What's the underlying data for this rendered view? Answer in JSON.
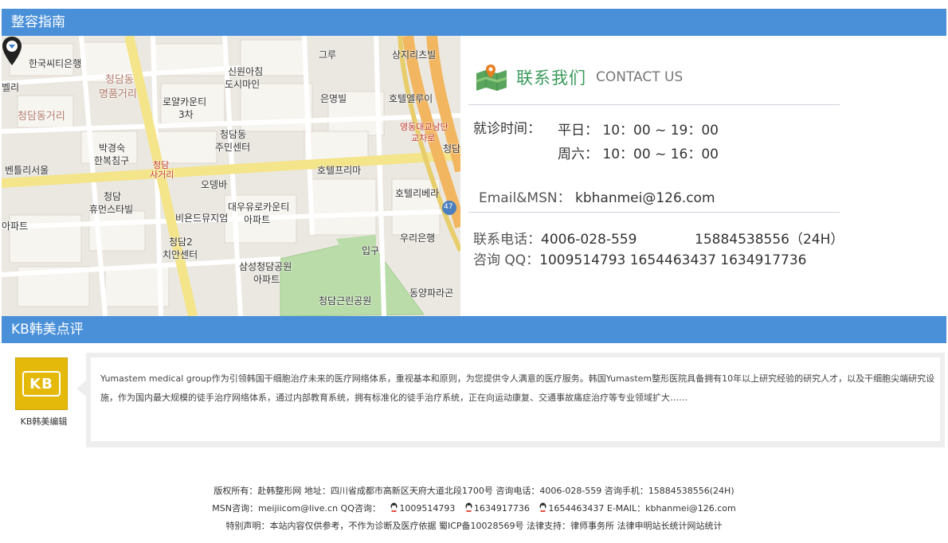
{
  "sections": {
    "guide_title": "整容指南",
    "review_title": "KB韩美点评"
  },
  "map": {
    "labels": [
      "한국씨티은행",
      "청담동",
      "명품거리",
      "청담동거리",
      "벨리",
      "로얄카운티",
      "3차",
      "신원아침",
      "도시마인",
      "그루",
      "상지리츠빌",
      "은명빌",
      "호텔엘루이",
      "영동대교남단",
      "교차로",
      "청담",
      "청담동",
      "주민센터",
      "박경숙",
      "한복침구",
      "벤틀리서울",
      "청담",
      "사거리",
      "오뎅바",
      "호텔프리마",
      "호텔리베라",
      "47",
      "청담",
      "휴먼스타빌",
      "비욘드뮤지엄",
      "대우유로카운티",
      "아파트",
      "청담2",
      "치안센터",
      "입구",
      "우리은행",
      "삼성청담공원",
      "아파트",
      "동양파라곤",
      "청담근린공원",
      "아파트"
    ]
  },
  "contact": {
    "title_cn": "联系我们",
    "title_en": "CONTACT US",
    "hours_label": "就诊时间：",
    "weekday": "平日： 10：00 ~ 19：00",
    "saturday": "周六： 10：00 ~ 16：00",
    "email_label": "Email&MSN：",
    "email_value": "kbhanmei@126.com",
    "phone_label": "联系电话：",
    "phone_value": "4006-028-559",
    "mobile_value": "15884538556（24H）",
    "qq_label": "咨询 QQ：",
    "qq_value": "1009514793  1654463437  1634917736"
  },
  "review": {
    "logo_text": "KB",
    "editor": "KB韩美编辑",
    "text": "Yumastem medical group作为引领韩国干细胞治疗未来的医疗网络体系，重视基本和原则，为您提供令人满意的医疗服务。韩国Yumastem整形医院具备拥有10年以上研究经验的研究人才，以及干细胞尖端研究设施，作为国内最大规模的徒手治疗网络体系，通过内部教育系统，拥有标准化的徒手治疗系统，正在向运动康复、交通事故痛症治疗等专业领域扩大……"
  },
  "footer": {
    "line1": "版权所有：赴韩整形网 地址：四川省成都市高新区天府大道北段1700号 咨询电话：4006-028-559 咨询手机：15884538556(24H)",
    "msn": "MSN咨询：meijiicom@live.cn QQ咨询：",
    "qq1": "1009514793",
    "qq2": "1634917736",
    "qq3": "1654463437",
    "email": " E-MAIL：kbhanmei@126.com",
    "line3a": "特别声明：本站内容仅供参考，不作为诊断及医疗依据 蜀ICP备10028569号 法律支持：",
    "line3_link1": "律师事务所",
    "line3_sep": " ",
    "line3_link2": "法律申明",
    "line3_link3": "站长统计",
    "line3_link4": "网站统计"
  }
}
